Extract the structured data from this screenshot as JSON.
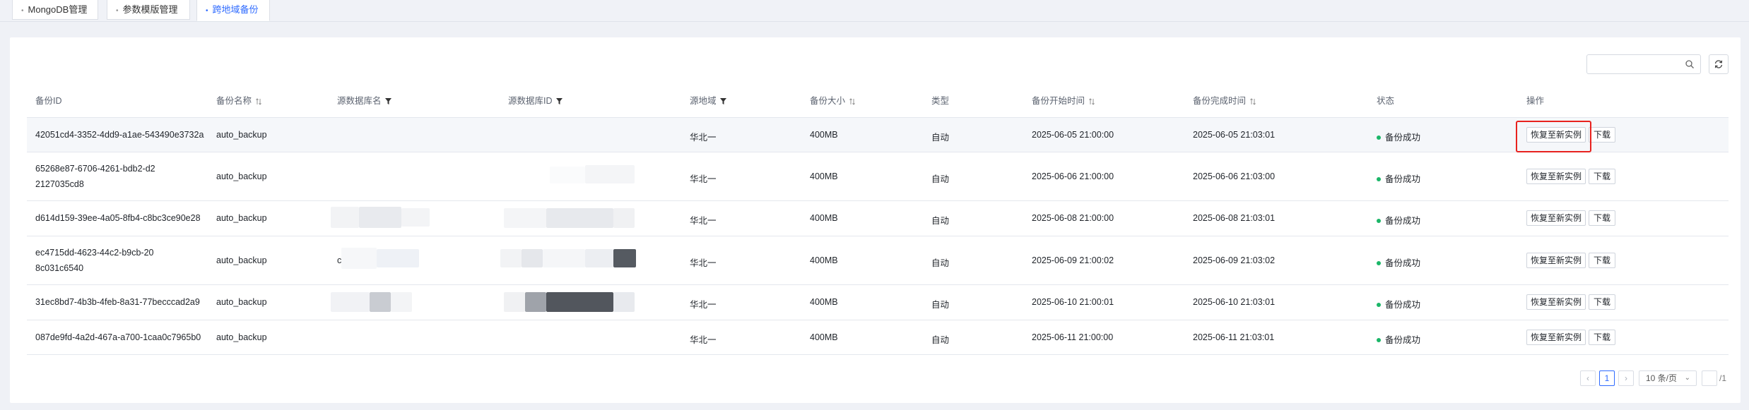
{
  "tabs": [
    {
      "label": "MongoDB管理",
      "active": false
    },
    {
      "label": "参数模版管理",
      "active": false
    },
    {
      "label": "跨地域备份",
      "active": true
    }
  ],
  "toolbar": {
    "search_placeholder": ""
  },
  "table": {
    "columns": [
      "备份ID",
      "备份名称",
      "源数据库名",
      "源数据库ID",
      "源地域",
      "备份大小",
      "类型",
      "备份开始时间",
      "备份完成时间",
      "状态",
      "操作"
    ],
    "rows": [
      {
        "id": "42051cd4-3352-4dd9-a1ae-543490e3732a",
        "name": "auto_backup",
        "src_db_name": "",
        "src_db_id": "",
        "region": "华北一",
        "size": "400MB",
        "type": "自动",
        "start": "2025-06-05 21:00:00",
        "end": "2025-06-05 21:03:01",
        "status": "备份成功",
        "restore": "恢复至新实例",
        "download": "下载"
      },
      {
        "id": "65268e87-6706-4261-bdb2-d22127035cd8",
        "name": "auto_backup",
        "src_db_name": "",
        "src_db_id": "",
        "region": "华北一",
        "size": "400MB",
        "type": "自动",
        "start": "2025-06-06 21:00:00",
        "end": "2025-06-06 21:03:00",
        "status": "备份成功",
        "restore": "恢复至新实例",
        "download": "下载"
      },
      {
        "id": "d614d159-39ee-4a05-8fb4-c8bc3ce90e28",
        "name": "auto_backup",
        "src_db_name": "",
        "src_db_id": "",
        "region": "华北一",
        "size": "400MB",
        "type": "自动",
        "start": "2025-06-08 21:00:00",
        "end": "2025-06-08 21:03:01",
        "status": "备份成功",
        "restore": "恢复至新实例",
        "download": "下载"
      },
      {
        "id": "ec4715dd-4623-44c2-b9cb-208c031c6540",
        "name": "auto_backup",
        "src_db_name": "c",
        "src_db_id": "",
        "region": "华北一",
        "size": "400MB",
        "type": "自动",
        "start": "2025-06-09 21:00:02",
        "end": "2025-06-09 21:03:02",
        "status": "备份成功",
        "restore": "恢复至新实例",
        "download": "下载"
      },
      {
        "id": "31ec8bd7-4b3b-4feb-8a31-77becccad2a9",
        "name": "auto_backup",
        "src_db_name": "",
        "src_db_id": "",
        "region": "华北一",
        "size": "400MB",
        "type": "自动",
        "start": "2025-06-10 21:00:01",
        "end": "2025-06-10 21:03:01",
        "status": "备份成功",
        "restore": "恢复至新实例",
        "download": "下载"
      },
      {
        "id": "087de9fd-4a2d-467a-a700-1caa0c7965b0",
        "name": "auto_backup",
        "src_db_name": "",
        "src_db_id": "",
        "region": "华北一",
        "size": "400MB",
        "type": "自动",
        "start": "2025-06-11 21:00:00",
        "end": "2025-06-11 21:03:01",
        "status": "备份成功",
        "restore": "恢复至新实例",
        "download": "下载"
      }
    ]
  },
  "pagination": {
    "current_page": "1",
    "page_size": "10 条/页",
    "total_pages": "/1"
  },
  "colors": {
    "accent": "#2f6bff",
    "success": "#1bb668",
    "highlight": "#e8221e"
  }
}
